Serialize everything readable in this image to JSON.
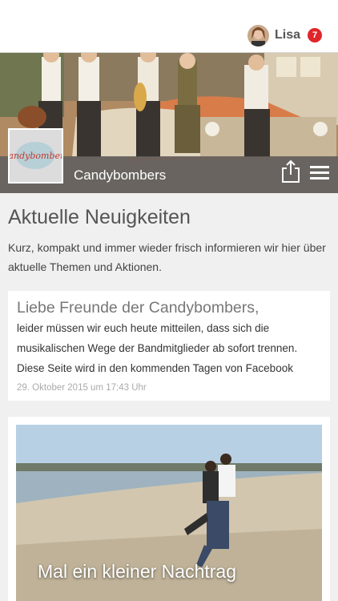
{
  "header": {
    "user_name": "Lisa",
    "notification_count": "7",
    "badge_color": "#e0262b"
  },
  "hero": {
    "page_name": "Candybombers",
    "logo_text": "Candybombers",
    "share_icon": "share-icon",
    "menu_icon": "hamburger-menu-icon"
  },
  "news": {
    "title": "Aktuelle Neuigkeiten",
    "intro": "Kurz, kompakt und immer wieder frisch informieren wir hier über aktuelle Themen und Aktionen."
  },
  "posts": [
    {
      "title": "Liebe Freunde der Candybombers,",
      "body": "leider müssen wir euch heute mitteilen, dass sich die musikalischen Wege der Bandmitglieder ab sofort trennen. Diese Seite wird in den kommenden Tagen von Facebook",
      "timestamp": "29. Oktober 2015 um 17:43 Uhr"
    },
    {
      "caption": "Mal ein kleiner Nachtrag"
    }
  ]
}
